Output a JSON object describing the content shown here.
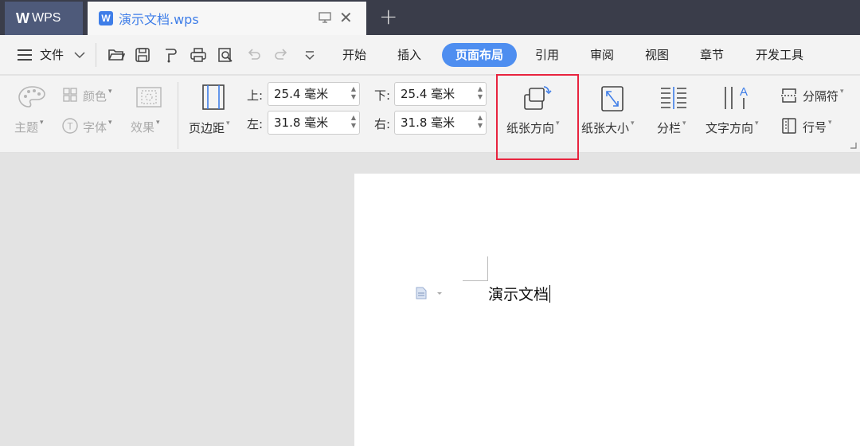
{
  "titlebar": {
    "app_tab": "WPS",
    "doc_tab": "演示文档.wps"
  },
  "menubar": {
    "file": "文件",
    "tabs": [
      "开始",
      "插入",
      "页面布局",
      "引用",
      "审阅",
      "视图",
      "章节",
      "开发工具"
    ],
    "active_tab": "页面布局"
  },
  "ribbon": {
    "theme": "主题",
    "color": "颜色",
    "font": "字体",
    "effect": "效果",
    "margin": "页边距",
    "top_label": "上:",
    "top_value": "25.4 毫米",
    "bottom_label": "下:",
    "bottom_value": "25.4 毫米",
    "left_label": "左:",
    "left_value": "31.8 毫米",
    "right_label": "右:",
    "right_value": "31.8 毫米",
    "orientation": "纸张方向",
    "size": "纸张大小",
    "columns": "分栏",
    "text_direction": "文字方向",
    "separator": "分隔符",
    "line_number": "行号"
  },
  "document": {
    "text": "演示文档"
  },
  "colors": {
    "accent": "#4e8ef0",
    "highlight": "#e8243f",
    "titlebar": "#3a3d4a"
  }
}
